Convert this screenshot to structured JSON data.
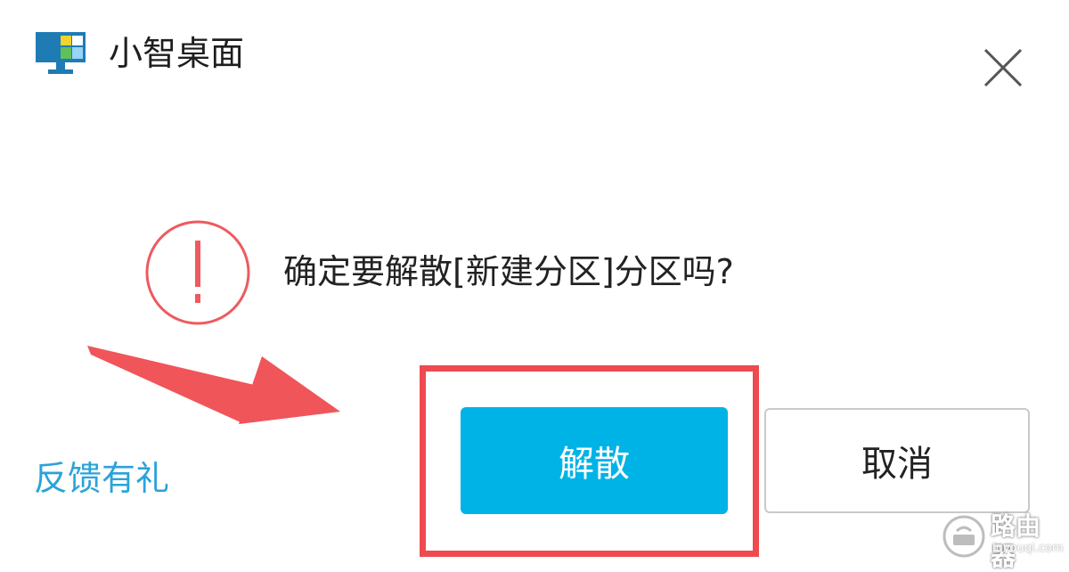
{
  "window": {
    "title": "小智桌面",
    "app_icon": "monitor-icon",
    "close_icon": "close-icon"
  },
  "dialog": {
    "icon": "warning-icon",
    "message": "确定要解散[新建分区]分区吗?",
    "confirm_label": "解散",
    "cancel_label": "取消",
    "feedback_link": "反馈有礼"
  },
  "annotations": {
    "arrow": "red-arrow-pointing-to-confirm-button",
    "highlight": "red-box-around-confirm-button"
  },
  "watermark": {
    "text": "路由器",
    "url": "luyouqi.com"
  },
  "colors": {
    "primary": "#00b3e6",
    "warning": "#ee5a5f",
    "link": "#2aa3d8",
    "annotation_red": "#ee4a4f"
  }
}
